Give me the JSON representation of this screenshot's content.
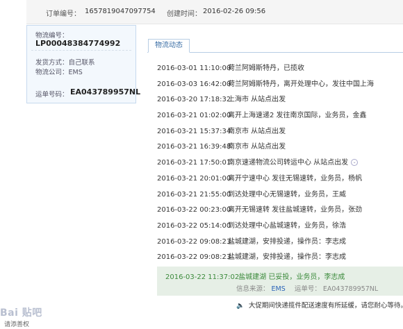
{
  "order": {
    "number_label": "订单编号：",
    "number_value": "1657819047097754",
    "created_label": "创建时间：",
    "created_value": "2016-02-26 09:56"
  },
  "logistics": {
    "tracking_label": "物流编号：",
    "tracking_value": "LP00048384774992",
    "ship_method": "发货方式：自己联系",
    "company": "物流公司：EMS",
    "waybill_label": "运单号码：",
    "waybill_value": "EA043789957NL"
  },
  "tab": {
    "label": "物流动态"
  },
  "events": [
    {
      "time": "2016-03-01 11:10:00",
      "desc": "荷兰阿姆斯特丹，已揽收"
    },
    {
      "time": "2016-03-03 16:42:00",
      "desc": "荷兰阿姆斯特丹，离开处理中心，发往中国上海"
    },
    {
      "time": "2016-03-20 17:18:32",
      "desc": "上海市 从站点出发"
    },
    {
      "time": "2016-03-21 01:02:00",
      "desc": "离开上海速递2 发往南京国际，业务员，金鑫"
    },
    {
      "time": "2016-03-21 15:37:34",
      "desc": "南京市 从站点出发"
    },
    {
      "time": "2016-03-21 16:39:48",
      "desc": "南京市 从站点出发"
    },
    {
      "time": "2016-03-21 17:50:01",
      "desc": "南京速递物流公司转运中心 从站点出发"
    },
    {
      "time": "2016-03-21 20:01:00",
      "desc": "离开宁速中心 发往无锡速转，业务员，杨帆"
    },
    {
      "time": "2016-03-21 21:55:00",
      "desc": "到达处理中心无锡速转，业务员，王威"
    },
    {
      "time": "2016-03-22 00:23:00",
      "desc": "离开无锡速转 发往盐城速转，业务员，张劲"
    },
    {
      "time": "2016-03-22 05:14:00",
      "desc": "到达处理中心盐城速转，业务员，徐浩"
    },
    {
      "time": "2016-03-22 09:08:23",
      "desc": "盐城建湖，安排投递，操作员：李志成"
    },
    {
      "time": "2016-03-22 09:08:23",
      "desc": "盐城建湖，安排投递，操作员：李志成"
    }
  ],
  "latest": {
    "time": "2016-03-22 11:37:02",
    "desc": "盐城建湖 已妥投，业务员，李志成",
    "source_label": "信息来源：",
    "source_value": "EMS",
    "waybill_label": "运单号：",
    "waybill_value": "EA043789957NL"
  },
  "notice": {
    "text": "大促期间快递揽件配送速度有所延缓，请您耐心等待。"
  },
  "watermark": {
    "text": "Bai 贴吧",
    "footer": "请添善权"
  },
  "colors": {
    "accent": "#3a6ea5",
    "delivered": "#3b8a3b",
    "link": "#2a63b8"
  }
}
